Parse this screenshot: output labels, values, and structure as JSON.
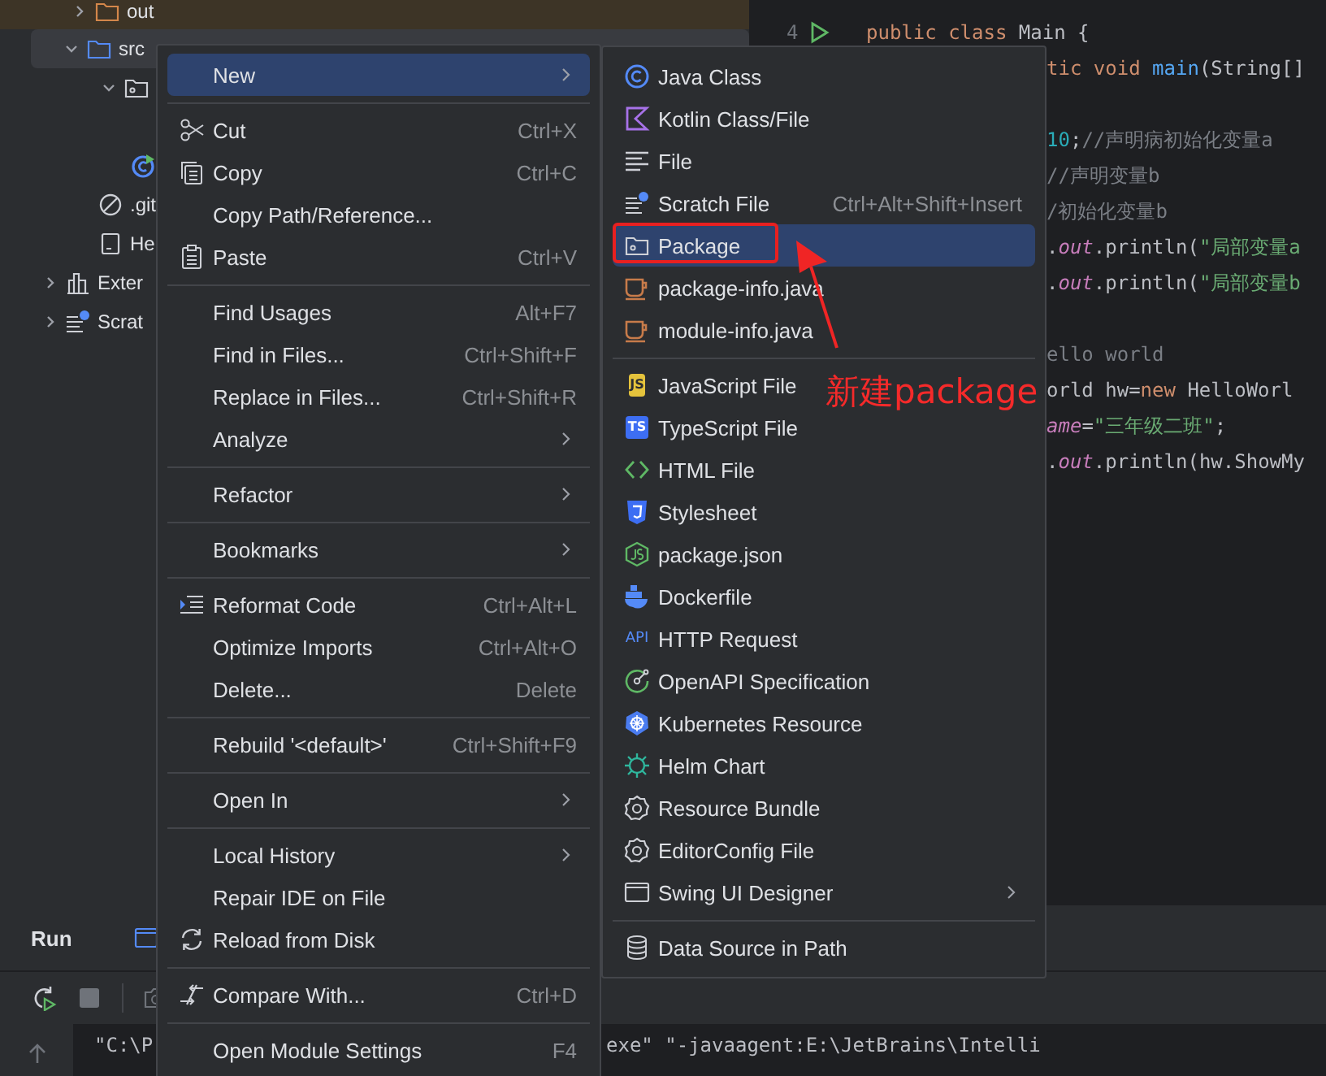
{
  "project_tree": {
    "items": [
      {
        "kind": "excluded-folder",
        "label": "out",
        "expanded": false
      },
      {
        "kind": "source-folder",
        "label": "src",
        "expanded": true,
        "selected": true,
        "children": [
          {
            "kind": "package",
            "expanded": true,
            "children": [
              {
                "kind": "class"
              }
            ]
          }
        ]
      },
      {
        "kind": "ignore-file",
        "label": ".git"
      },
      {
        "kind": "file",
        "label": "He"
      }
    ],
    "top_items": [
      {
        "kind": "libraries",
        "label": "Exter",
        "expanded": false
      },
      {
        "kind": "scratches",
        "label": "Scrat",
        "expanded": false
      }
    ]
  },
  "editor": {
    "line_number": "4",
    "lines": [
      {
        "kind": "full",
        "tokens": [
          {
            "kind": "keyword",
            "text": "public class "
          },
          {
            "kind": "plain",
            "text": "Main {"
          }
        ]
      },
      {
        "kind": "clipped",
        "tokens": [
          {
            "kind": "keyword",
            "text": "tic void "
          },
          {
            "kind": "method",
            "text": "main"
          },
          {
            "kind": "plain",
            "text": "(String[]"
          }
        ]
      },
      {
        "kind": "blank"
      },
      {
        "kind": "clipped",
        "tokens": [
          {
            "kind": "number",
            "text": "10"
          },
          {
            "kind": "plain",
            "text": ";"
          },
          {
            "kind": "comment",
            "text": "//声明病初始化变量a"
          }
        ]
      },
      {
        "kind": "clipped",
        "tokens": [
          {
            "kind": "comment",
            "text": "//声明变量b"
          }
        ]
      },
      {
        "kind": "clipped",
        "tokens": [
          {
            "kind": "comment",
            "text": "/初始化变量b"
          }
        ]
      },
      {
        "kind": "clipped",
        "tokens": [
          {
            "kind": "plain",
            "text": "."
          },
          {
            "kind": "field",
            "text": "out"
          },
          {
            "kind": "plain",
            "text": ".println("
          },
          {
            "kind": "string",
            "text": "\"局部变量a"
          }
        ]
      },
      {
        "kind": "clipped",
        "tokens": [
          {
            "kind": "plain",
            "text": "."
          },
          {
            "kind": "field",
            "text": "out"
          },
          {
            "kind": "plain",
            "text": ".println("
          },
          {
            "kind": "string",
            "text": "\"局部变量b"
          }
        ]
      },
      {
        "kind": "blank"
      },
      {
        "kind": "clipped",
        "tokens": [
          {
            "kind": "comment",
            "text": "ello world"
          }
        ]
      },
      {
        "kind": "clipped",
        "tokens": [
          {
            "kind": "plain",
            "text": "orld hw="
          },
          {
            "kind": "keyword",
            "text": "new"
          },
          {
            "kind": "plain",
            "text": " HelloWorl"
          }
        ]
      },
      {
        "kind": "clipped",
        "tokens": [
          {
            "kind": "field",
            "text": "ame"
          },
          {
            "kind": "plain",
            "text": "="
          },
          {
            "kind": "string",
            "text": "\"三年级二班\""
          },
          {
            "kind": "plain",
            "text": ";"
          }
        ]
      },
      {
        "kind": "clipped",
        "tokens": [
          {
            "kind": "plain",
            "text": "."
          },
          {
            "kind": "field",
            "text": "out"
          },
          {
            "kind": "plain",
            "text": ".println(hw.ShowMy"
          }
        ]
      }
    ]
  },
  "run_panel": {
    "title": "Run",
    "console": {
      "left_text": "\"C:\\P",
      "right_text": "exe\" \"-javaagent:E:\\JetBrains\\Intelli"
    }
  },
  "context_menu": {
    "entries": [
      {
        "kind": "item",
        "label": "New",
        "selected": true,
        "submenu": true
      },
      {
        "kind": "separator"
      },
      {
        "kind": "item",
        "label": "Cut",
        "shortcut": "Ctrl+X",
        "selected": false
      },
      {
        "kind": "item",
        "label": "Copy",
        "shortcut": "Ctrl+C",
        "selected": false
      },
      {
        "kind": "item",
        "label": "Copy Path/Reference...",
        "selected": false
      },
      {
        "kind": "item",
        "label": "Paste",
        "shortcut": "Ctrl+V",
        "selected": false
      },
      {
        "kind": "separator"
      },
      {
        "kind": "item",
        "label": "Find Usages",
        "shortcut": "Alt+F7",
        "selected": false
      },
      {
        "kind": "item",
        "label": "Find in Files...",
        "shortcut": "Ctrl+Shift+F",
        "selected": false
      },
      {
        "kind": "item",
        "label": "Replace in Files...",
        "shortcut": "Ctrl+Shift+R",
        "selected": false
      },
      {
        "kind": "item",
        "label": "Analyze",
        "selected": false,
        "submenu": true
      },
      {
        "kind": "separator"
      },
      {
        "kind": "item",
        "label": "Refactor",
        "selected": false,
        "submenu": true
      },
      {
        "kind": "separator"
      },
      {
        "kind": "item",
        "label": "Bookmarks",
        "selected": false,
        "submenu": true
      },
      {
        "kind": "separator"
      },
      {
        "kind": "item",
        "label": "Reformat Code",
        "shortcut": "Ctrl+Alt+L",
        "selected": false
      },
      {
        "kind": "item",
        "label": "Optimize Imports",
        "shortcut": "Ctrl+Alt+O",
        "selected": false
      },
      {
        "kind": "item",
        "label": "Delete...",
        "shortcut": "Delete",
        "selected": false
      },
      {
        "kind": "separator"
      },
      {
        "kind": "item",
        "label": "Rebuild '<default>'",
        "shortcut": "Ctrl+Shift+F9",
        "selected": false
      },
      {
        "kind": "separator"
      },
      {
        "kind": "item",
        "label": "Open In",
        "selected": false,
        "submenu": true
      },
      {
        "kind": "separator"
      },
      {
        "kind": "item",
        "label": "Local History",
        "selected": false,
        "submenu": true
      },
      {
        "kind": "item",
        "label": "Repair IDE on File",
        "selected": false
      },
      {
        "kind": "item",
        "label": "Reload from Disk",
        "selected": false
      },
      {
        "kind": "separator"
      },
      {
        "kind": "item",
        "label": "Compare With...",
        "shortcut": "Ctrl+D",
        "selected": false
      },
      {
        "kind": "separator"
      },
      {
        "kind": "item",
        "label": "Open Module Settings",
        "shortcut": "F4",
        "selected": false
      }
    ]
  },
  "new_submenu": {
    "entries": [
      {
        "kind": "item",
        "label": "Java Class",
        "selected": false
      },
      {
        "kind": "item",
        "label": "Kotlin Class/File",
        "selected": false
      },
      {
        "kind": "item",
        "label": "File",
        "selected": false
      },
      {
        "kind": "item",
        "label": "Scratch File",
        "shortcut": "Ctrl+Alt+Shift+Insert",
        "selected": false
      },
      {
        "kind": "item",
        "label": "Package",
        "selected": true
      },
      {
        "kind": "item",
        "label": "package-info.java",
        "selected": false
      },
      {
        "kind": "item",
        "label": "module-info.java",
        "selected": false
      },
      {
        "kind": "separator"
      },
      {
        "kind": "item",
        "label": "JavaScript File",
        "icon_text": "JS",
        "selected": false
      },
      {
        "kind": "item",
        "label": "TypeScript File",
        "icon_text": "TS",
        "selected": false
      },
      {
        "kind": "item",
        "label": "HTML File",
        "selected": false
      },
      {
        "kind": "item",
        "label": "Stylesheet",
        "selected": false
      },
      {
        "kind": "item",
        "label": "package.json",
        "selected": false
      },
      {
        "kind": "item",
        "label": "Dockerfile",
        "selected": false
      },
      {
        "kind": "item",
        "label": "HTTP Request",
        "icon_text": "API",
        "selected": false
      },
      {
        "kind": "item",
        "label": "OpenAPI Specification",
        "selected": false
      },
      {
        "kind": "item",
        "label": "Kubernetes Resource",
        "selected": false
      },
      {
        "kind": "item",
        "label": "Helm Chart",
        "selected": false
      },
      {
        "kind": "item",
        "label": "Resource Bundle",
        "selected": false
      },
      {
        "kind": "item",
        "label": "EditorConfig File",
        "selected": false
      },
      {
        "kind": "item",
        "label": "Swing UI Designer",
        "selected": false,
        "submenu": true
      },
      {
        "kind": "separator"
      },
      {
        "kind": "item",
        "label": "Data Source in Path",
        "selected": false
      }
    ]
  },
  "annotation": {
    "text": "新建package"
  }
}
